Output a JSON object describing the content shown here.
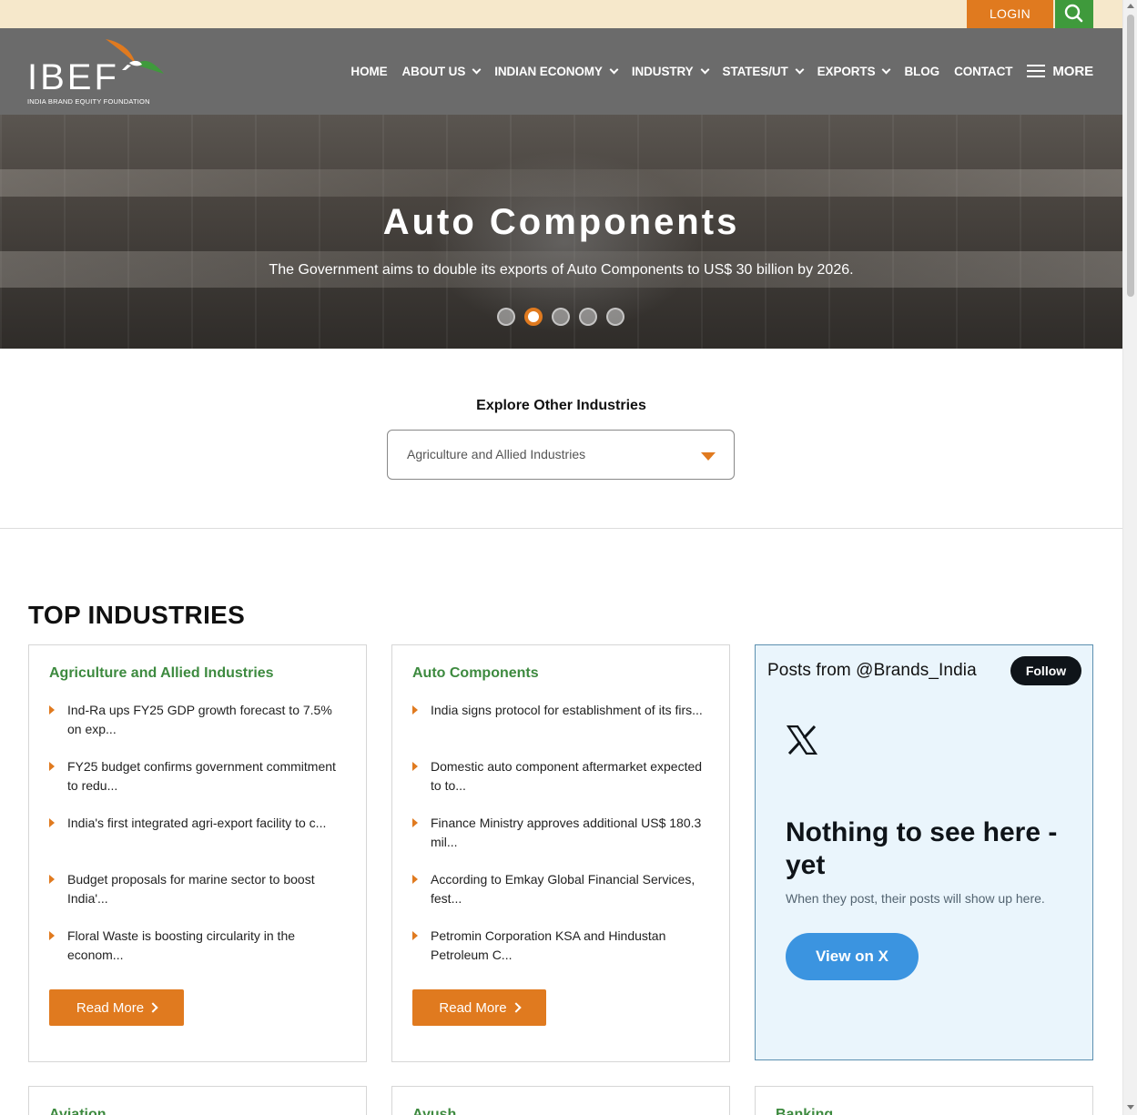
{
  "topbar": {
    "login_label": "LOGIN",
    "search_icon": "search-icon"
  },
  "logo": {
    "text": "IBEF",
    "subtitle": "INDIA BRAND EQUITY FOUNDATION"
  },
  "nav": {
    "items": [
      {
        "label": "HOME",
        "dropdown": false
      },
      {
        "label": "ABOUT US",
        "dropdown": true
      },
      {
        "label": "INDIAN ECONOMY",
        "dropdown": true
      },
      {
        "label": "INDUSTRY",
        "dropdown": true
      },
      {
        "label": "STATES/UT",
        "dropdown": true
      },
      {
        "label": "EXPORTS",
        "dropdown": true
      },
      {
        "label": "BLOG",
        "dropdown": false
      },
      {
        "label": "CONTACT",
        "dropdown": false
      }
    ],
    "more_label": "MORE"
  },
  "hero": {
    "title": "Auto Components",
    "subtitle": "The Government aims to double its exports of Auto Components to US$ 30 billion by 2026.",
    "slide_count": 5,
    "active_slide": 2
  },
  "explore": {
    "title": "Explore Other Industries",
    "selected": "Agriculture and Allied Industries"
  },
  "top_industries": {
    "title": "TOP INDUSTRIES",
    "cards": [
      {
        "title": "Agriculture and Allied Industries",
        "items": [
          "Ind-Ra ups FY25 GDP growth forecast to 7.5% on exp...",
          "FY25 budget confirms government commitment to redu...",
          "India's first integrated agri-export facility to c...",
          "Budget proposals for marine sector to boost India'...",
          "Floral Waste is boosting circularity in the econom..."
        ],
        "button": "Read More"
      },
      {
        "title": "Auto Components",
        "items": [
          "India signs protocol for establishment of its firs...",
          "Domestic auto component aftermarket expected to to...",
          "Finance Ministry approves additional US$ 180.3 mil...",
          "According to Emkay Global Financial Services, fest...",
          "Petromin Corporation KSA and Hindustan Petroleum C..."
        ],
        "button": "Read More"
      }
    ],
    "row2_titles": [
      "Aviation",
      "Ayush",
      "Banking"
    ]
  },
  "twitter": {
    "header": "Posts from @Brands_India",
    "follow": "Follow",
    "empty_title": "Nothing to see here - yet",
    "empty_sub": "When they post, their posts will show up here.",
    "view_button": "View on X"
  },
  "colors": {
    "accent": "#e07a1f",
    "green": "#3d8a3f",
    "nav_bg": "#6b6b6b",
    "topstrip": "#f6e8cb"
  }
}
